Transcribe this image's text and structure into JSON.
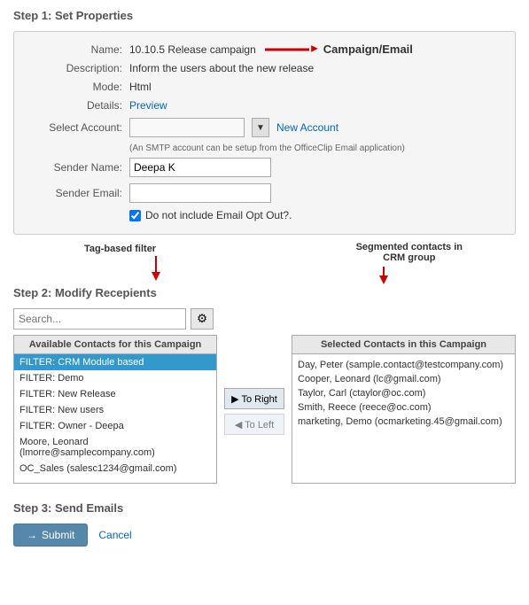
{
  "step1": {
    "header": "Step 1: Set Properties",
    "fields": {
      "name_label": "Name:",
      "name_value": "10.10.5 Release campaign",
      "campaign_email_label": "Campaign/Email",
      "description_label": "Description:",
      "description_value": "Inform the users about the new release",
      "mode_label": "Mode:",
      "mode_value": "Html",
      "details_label": "Details:",
      "details_link": "Preview",
      "select_account_label": "Select Account:",
      "new_account_link": "New Account",
      "smtp_note": "(An SMTP account can be setup from the OfficeClip Email application)",
      "sender_name_label": "Sender Name:",
      "sender_name_value": "Deepa K",
      "sender_email_label": "Sender Email:",
      "sender_email_value": "",
      "checkbox_label": "Do not include Email Opt Out?."
    }
  },
  "step2": {
    "header": "Step 2: Modify Recepients",
    "search_placeholder": "Search...",
    "available_title": "Available Contacts for this Campaign",
    "available_contacts": [
      {
        "label": "FILTER: CRM Module based",
        "selected": true
      },
      {
        "label": "FILTER: Demo",
        "selected": false
      },
      {
        "label": "FILTER: New Release",
        "selected": false
      },
      {
        "label": "FILTER: New users",
        "selected": false
      },
      {
        "label": "FILTER: Owner - Deepa",
        "selected": false
      },
      {
        "label": "Moore, Leonard (lmorre@samplecompany.com)",
        "selected": false
      },
      {
        "label": "OC_Sales (salesc1234@gmail.com)",
        "selected": false
      }
    ],
    "to_right_label": "▶ To Right",
    "to_left_label": "◀ To Left",
    "selected_title": "Selected Contacts in this Campaign",
    "selected_contacts": [
      "Day, Peter (sample.contact@testcompany.com)",
      "Cooper, Leonard (lc@gmail.com)",
      "Taylor, Carl (ctaylor@oc.com)",
      "Smith, Reece (reece@oc.com)",
      "marketing, Demo (ocmarketing.45@gmail.com)"
    ],
    "annotation_tag_filter": "Tag-based filter",
    "annotation_segmented": "Segmented contacts in\nCRM group"
  },
  "step3": {
    "header": "Step 3: Send Emails",
    "submit_label": "→ Submit",
    "cancel_label": "Cancel"
  },
  "icons": {
    "search_icon": "🔍",
    "arrow_right": "▶",
    "arrow_left": "◀",
    "submit_arrow": "→",
    "dropdown_arrow": "▼"
  }
}
